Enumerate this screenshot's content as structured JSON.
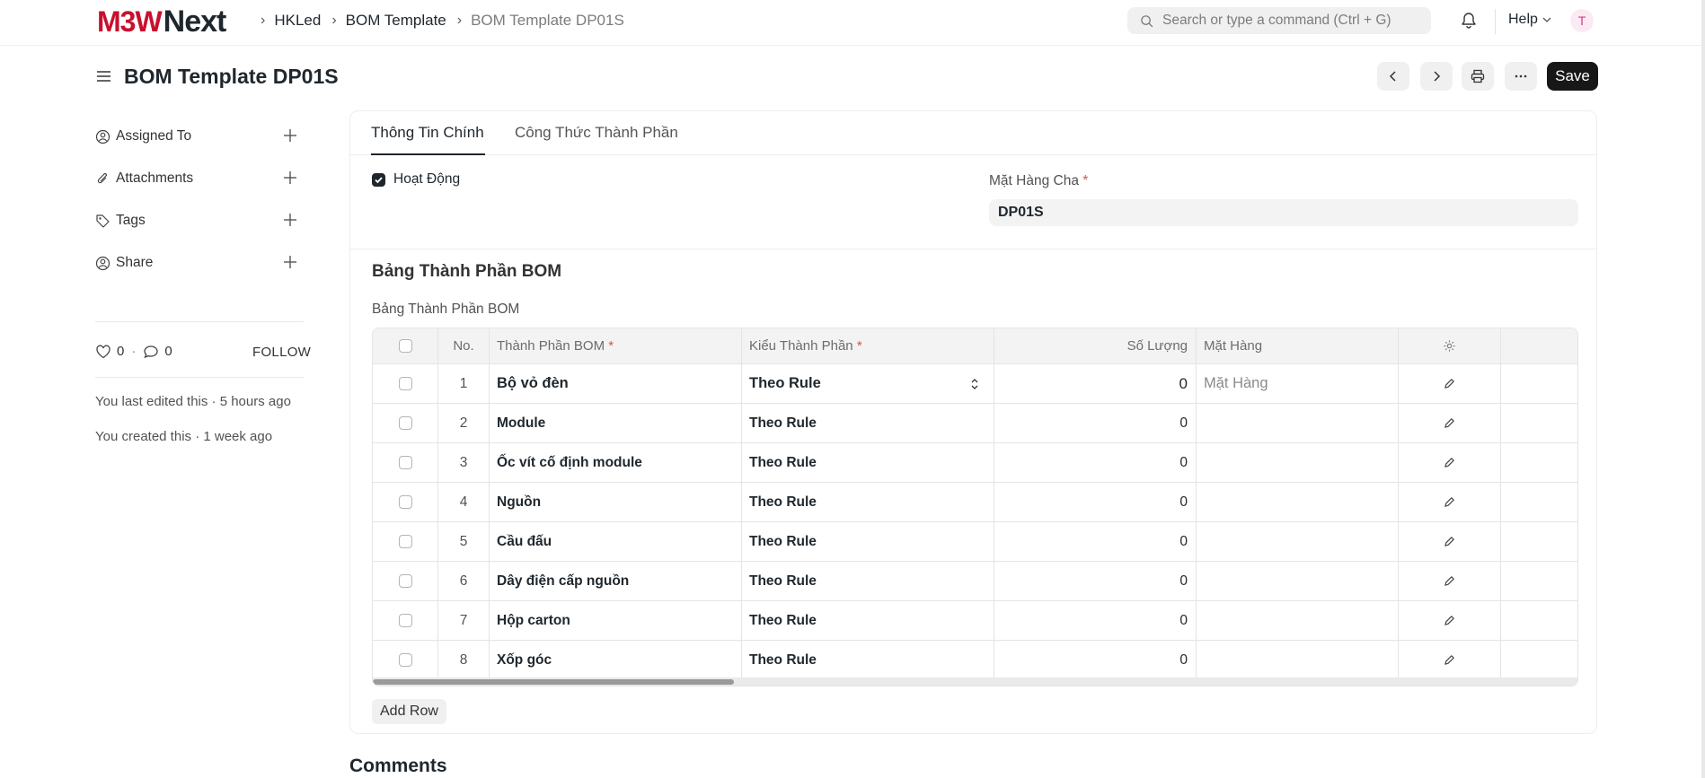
{
  "navbar": {
    "logo_m3w": "M3W",
    "logo_next": "Next",
    "breadcrumbs": [
      "HKLed",
      "BOM Template",
      "BOM Template DP01S"
    ],
    "search_placeholder": "Search or type a command (Ctrl + G)",
    "help_label": "Help",
    "avatar_initial": "T"
  },
  "page": {
    "title": "BOM Template DP01S",
    "save_label": "Save"
  },
  "sidebar": {
    "items": [
      {
        "label": "Assigned To",
        "icon": "user-plus-icon"
      },
      {
        "label": "Attachments",
        "icon": "paperclip-icon"
      },
      {
        "label": "Tags",
        "icon": "tag-icon"
      },
      {
        "label": "Share",
        "icon": "share-user-icon"
      }
    ],
    "likes": "0",
    "comments_count": "0",
    "follow_label": "FOLLOW",
    "last_edited": "You last edited this · 5 hours ago",
    "created": "You created this · 1 week ago"
  },
  "tabs": [
    "Thông Tin Chính",
    "Công Thức Thành Phần"
  ],
  "form": {
    "active_label": "Hoạt Động",
    "active_checked": true,
    "parent_item_label": "Mặt Hàng Cha",
    "parent_item_value": "DP01S",
    "section_title": "Bảng Thành Phần BOM",
    "table_label": "Bảng Thành Phần BOM"
  },
  "table": {
    "columns": [
      "No.",
      "Thành Phần BOM",
      "Kiểu Thành Phần",
      "Số Lượng",
      "Mặt Hàng"
    ],
    "item_placeholder": "Mặt Hàng",
    "rows": [
      {
        "no": "1",
        "component": "Bộ vỏ đèn",
        "kind": "Theo Rule",
        "qty": "0",
        "item": ""
      },
      {
        "no": "2",
        "component": "Module",
        "kind": "Theo Rule",
        "qty": "0",
        "item": ""
      },
      {
        "no": "3",
        "component": "Ốc vít cố định module",
        "kind": "Theo Rule",
        "qty": "0",
        "item": ""
      },
      {
        "no": "4",
        "component": "Nguồn",
        "kind": "Theo Rule",
        "qty": "0",
        "item": ""
      },
      {
        "no": "5",
        "component": "Cầu đấu",
        "kind": "Theo Rule",
        "qty": "0",
        "item": ""
      },
      {
        "no": "6",
        "component": "Dây điện cấp nguồn",
        "kind": "Theo Rule",
        "qty": "0",
        "item": ""
      },
      {
        "no": "7",
        "component": "Hộp carton",
        "kind": "Theo Rule",
        "qty": "0",
        "item": ""
      },
      {
        "no": "8",
        "component": "Xốp góc",
        "kind": "Theo Rule",
        "qty": "0",
        "item": ""
      }
    ],
    "add_row_label": "Add Row"
  },
  "comments_title": "Comments",
  "colors": {
    "brand_red": "#c8102e",
    "primary_dark": "#171717",
    "required": "#e24c4c"
  }
}
